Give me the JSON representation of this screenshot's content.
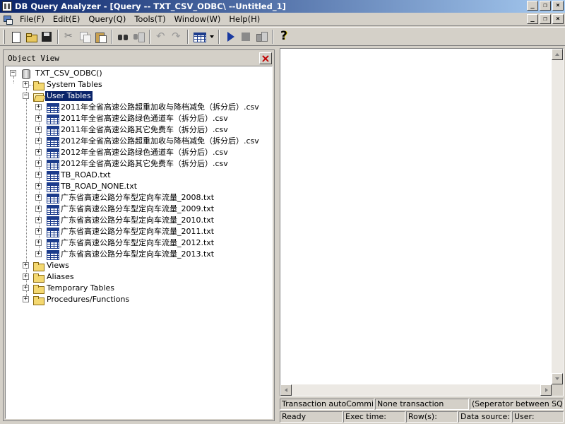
{
  "window": {
    "title": "DB Query Analyzer - [Query -- TXT_CSV_ODBC\\  --Untitled_1]",
    "controls": {
      "minimize": "_",
      "restore": "❐",
      "close": "×"
    }
  },
  "menu": {
    "items": [
      "File(F)",
      "Edit(E)",
      "Query(Q)",
      "Tools(T)",
      "Window(W)",
      "Help(H)"
    ]
  },
  "toolbar": {
    "buttons": [
      "new-icon",
      "open-icon",
      "save-icon",
      "cut-icon",
      "copy-icon",
      "paste-icon",
      "find-icon",
      "replace-icon",
      "undo-icon",
      "redo-icon",
      "grid-view-icon",
      "dropdown-icon",
      "run-icon",
      "stop-icon",
      "step-icon",
      "help-icon"
    ]
  },
  "object_view": {
    "title": "Object View",
    "close": "×",
    "root": "TXT_CSV_ODBC()",
    "folders": {
      "system_tables": "System Tables",
      "user_tables": "User Tables",
      "views": "Views",
      "aliases": "Aliases",
      "temporary_tables": "Temporary Tables",
      "procedures": "Procedures/Functions"
    },
    "tables": [
      "2011年全省高速公路超重加收与降档减免（拆分后）.csv",
      "2011年全省高速公路绿色通道车（拆分后）.csv",
      "2011年全省高速公路其它免费车（拆分后）.csv",
      "2012年全省高速公路超重加收与降档减免（拆分后）.csv",
      "2012年全省高速公路绿色通道车（拆分后）.csv",
      "2012年全省高速公路其它免费车（拆分后）.csv",
      "TB_ROAD.txt",
      "TB_ROAD_NONE.txt",
      "广东省高速公路分车型定向车流量_2008.txt",
      "广东省高速公路分车型定向车流量_2009.txt",
      "广东省高速公路分车型定向车流量_2010.txt",
      "广东省高速公路分车型定向车流量_2011.txt",
      "广东省高速公路分车型定向车流量_2012.txt",
      "广东省高速公路分车型定向车流量_2013.txt"
    ]
  },
  "status": {
    "top": [
      "Transaction autoCommit: O",
      "None transaction",
      "(Seperator between SQL)"
    ],
    "bottom": [
      "Ready",
      "Exec time:",
      "Row(s):",
      "Data source: T",
      "User:"
    ]
  }
}
